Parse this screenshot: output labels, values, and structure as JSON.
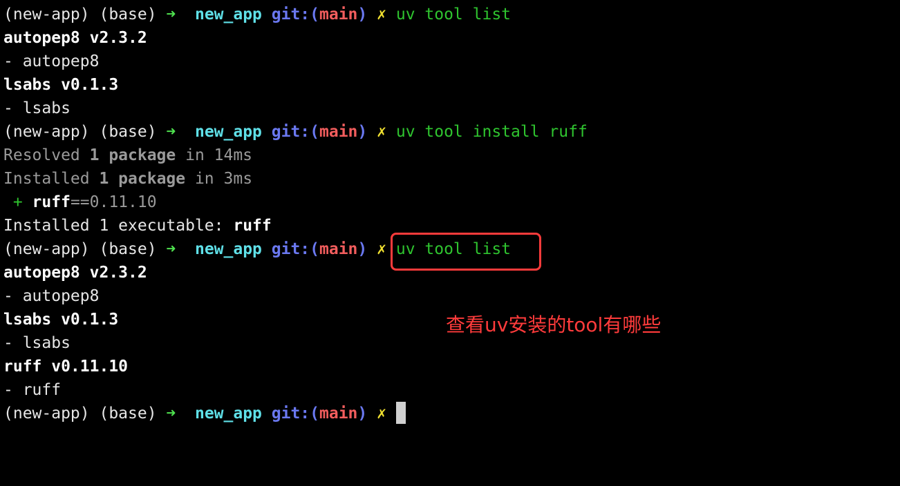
{
  "prompt": {
    "env": "(new-app) (base) ",
    "arrow": "➜",
    "dir": "new_app",
    "git_open": "git:(",
    "branch": "main",
    "git_close": ")",
    "dirty": "✗"
  },
  "commands": {
    "c1": "uv tool list",
    "c2": "uv tool install ruff",
    "c3": "uv tool list"
  },
  "output1": {
    "l1": "autopep8 v2.3.2",
    "l2": "- autopep8",
    "l3": "lsabs v0.1.3",
    "l4": "- lsabs"
  },
  "install": {
    "resolved_word": "Resolved ",
    "resolved_bold": "1 package",
    "resolved_time": " in 14ms",
    "installed_word": "Installed ",
    "installed_bold": "1 package",
    "installed_time": " in 3ms",
    "plus": " + ",
    "pkg_name": "ruff",
    "pkg_version": "==0.11.10",
    "exec_text": "Installed 1 executable: ",
    "exec_name": "ruff"
  },
  "output2": {
    "l1": "autopep8 v2.3.2",
    "l2": "- autopep8",
    "l3": "lsabs v0.1.3",
    "l4": "- lsabs",
    "l5": "ruff v0.11.10",
    "l6": "- ruff"
  },
  "annotation": "查看uv安装的tool有哪些",
  "colors": {
    "background": "#000000",
    "arrow": "#4fe24f",
    "dir": "#5fe0e8",
    "git": "#6a78f0",
    "branch": "#f25d5d",
    "dirty": "#f0e030",
    "command": "#2fc42f",
    "annotation": "#ff3b3b"
  }
}
